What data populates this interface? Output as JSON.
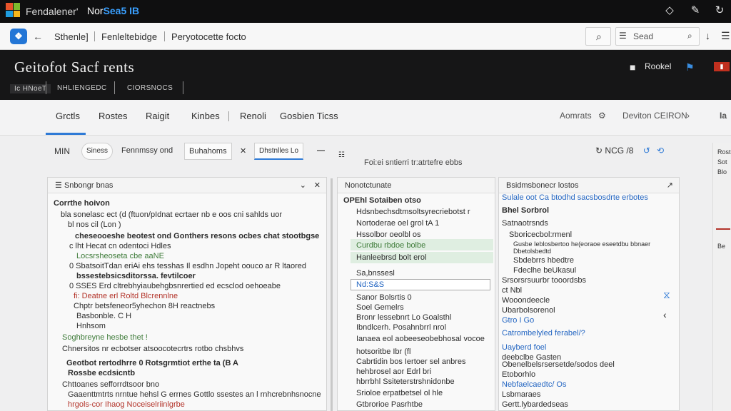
{
  "titlebar": {
    "app_name": "Fendalener'",
    "product_prefix": "Nor",
    "product_suffix": "Sea5 IB"
  },
  "navbar": {
    "links": [
      "Sthenle]",
      "Fenleltebidge",
      "Peryotocette focto"
    ],
    "search_placeholder": "Sead"
  },
  "header": {
    "title": "Geitofot Sacf rents",
    "tabs": [
      "Ic HNoeT",
      "NHLIENGEDC",
      "CIORSNOCS"
    ],
    "button_label": "Rookel"
  },
  "tabs": {
    "items": [
      "Grctls",
      "Rostes",
      "Raigit",
      "Kinbes",
      "Renoli",
      "Gosbien Ticss"
    ],
    "right_items": [
      "Aomrats",
      "Deviton CEIRON",
      "Ia"
    ]
  },
  "toolbar": {
    "left_label": "MIN",
    "dropdown_label": "Siness",
    "field_label": "Fennmssy ond",
    "box1_label": "Buhahoms",
    "box2_label": "Dhstnlles Lo",
    "right_label": "NCG /8"
  },
  "left_panel": {
    "header": "Snbongr bnas",
    "lines": [
      "Corrthe hoivon",
      "bla sonelasc ect (d (ftuon/pIdnat ecrtaer nb e oos cni sahlds uor",
      "bl nos cil (Lon )",
      "cheseooeshe beotest ond Gonthers resons ocbes chat stootbgse",
      "c lht Hecat cn odentoci Hdles",
      "Locsrsheoseta cbe aaNE",
      "0 SbatsoitTdan eriAi ehs tesshas Il esdhn Jopeht oouco ar R ltaored",
      "bssestebsicsditorssa. fevtilcoer",
      "0 SSES Erd cltrebhyiaubehgbsnrertied ed ecsclod oehoeabe",
      "fi: Deatne erl Roltd Blcrennlne",
      "Chptr betsfeneor5yhechon 8H reactnebs",
      "Basbonble. C H",
      "Hnhsom",
      "Soghbreyne hesbe thet !",
      "Chnersitos nr ecbotser atsoocotecrtrs rotbo chsbhvs",
      "Geotbot rertodhrre 0 Rotsgrmtiot erthe ta (B A",
      "Rossbe ecdsicntb",
      "Chttoanes sefforrdtsoor bno",
      "Gaaenttmtrts nrntue hehsl G errnes Gottlo ssestes an l rnhcrebnhsnocne",
      "hrgols-cor Ihaog Noceiselriinlgrbe"
    ]
  },
  "middle_panel": {
    "header": "Nonotctunate",
    "lines": [
      "OPEhl Sotaiben otso",
      "Hdsnbechsdtmsoltsyrecriebotst r",
      "Nortoderae oel grol tA 1",
      "Hssolbor oeolbl os",
      "Curdbu rbdoe bolbe",
      "Hanleebrsd bolt erol",
      "Sa,bnssesl",
      "Nd:S&S",
      "Sanor Bolsrtis 0",
      "Soel Gemelrs",
      "Bronr lessebnrt Lo Goalsthl",
      "Ibndlcerh. Posahnbrrl nrol",
      "Ianaea eol aobeeseobebhosal vocoe",
      "hotsoritbe Ibr (fl",
      "Cabrtidin bos Iertoer sel anbres",
      "hehbrosel aor Edrl bri",
      "hbrrbhl Ssiteterstrshnidonbe",
      "Srioloe erpatbetsel ol hle",
      "Gtbrorioe Pasrhtbe"
    ]
  },
  "right_panel": {
    "header": "Bsidmsbonecr lostos",
    "lines": [
      "Sulale oot Ca btodhd sacsbosdrte erbotes",
      "Bhel Sorbrol",
      "Satnaotrsnds",
      "Sboricecbol:rmenl",
      "Gusbe Ieblosbertoo he(eoraoe eseetdbu bbnaer",
      "Dbetolsbedtd",
      "Sbdebrrs hbedtre",
      "Fdeclhe beUkasul",
      "Srsorsrsuurbr tooordsbs",
      "ct Nbl",
      "Wooondeecle",
      "Ubarbolsorenol",
      "Gtro I Go",
      "Catrombelyled ferabel/?",
      "Uayberd foel",
      "deebclbe Gasten",
      "Obenelbelsrsersetde/sodos deel",
      "Etoborhlo",
      "Nebfaelcaedtc/ Os",
      "Lsbmaraes",
      "Gertt.lybardedseas"
    ]
  },
  "right_strip": {
    "lines": [
      "Rost",
      "Sot",
      "Blo",
      "Be"
    ]
  }
}
